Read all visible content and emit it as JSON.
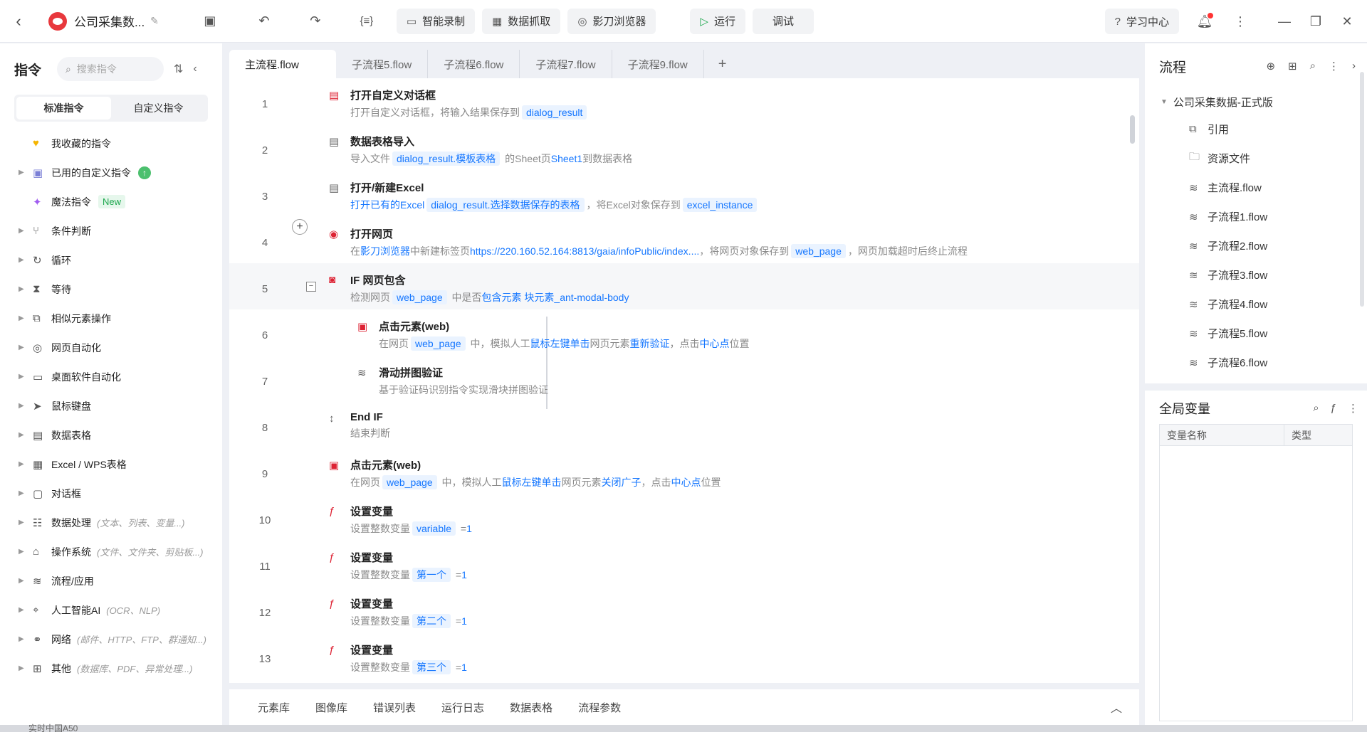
{
  "topbar": {
    "title": "公司采集数...",
    "buttons": {
      "record": "智能录制",
      "scrape": "数据抓取",
      "browser": "影刀浏览器",
      "run": "运行",
      "debug": "调试",
      "learn": "学习中心"
    }
  },
  "left": {
    "title": "指令",
    "search_placeholder": "搜索指令",
    "tabs": [
      "标准指令",
      "自定义指令"
    ],
    "items": [
      {
        "label": "我收藏的指令",
        "icon": "heart-icon",
        "arrow": false,
        "hint": ""
      },
      {
        "label": "已用的自定义指令",
        "icon": "calendar-check-icon",
        "arrow": true,
        "hint": ""
      },
      {
        "label": "魔法指令",
        "icon": "sparkle-icon",
        "arrow": false,
        "hint": ""
      },
      {
        "label": "条件判断",
        "icon": "branch-icon",
        "arrow": true,
        "hint": ""
      },
      {
        "label": "循环",
        "icon": "loop-icon",
        "arrow": true,
        "hint": ""
      },
      {
        "label": "等待",
        "icon": "hourglass-icon",
        "arrow": true,
        "hint": ""
      },
      {
        "label": "相似元素操作",
        "icon": "copy-icon",
        "arrow": true,
        "hint": ""
      },
      {
        "label": "网页自动化",
        "icon": "browser-icon",
        "arrow": true,
        "hint": ""
      },
      {
        "label": "桌面软件自动化",
        "icon": "monitor-icon",
        "arrow": true,
        "hint": ""
      },
      {
        "label": "鼠标键盘",
        "icon": "cursor-icon",
        "arrow": true,
        "hint": ""
      },
      {
        "label": "数据表格",
        "icon": "document-icon",
        "arrow": true,
        "hint": ""
      },
      {
        "label": "Excel / WPS表格",
        "icon": "excel-icon",
        "arrow": true,
        "hint": ""
      },
      {
        "label": "对话框",
        "icon": "dialog-icon",
        "arrow": true,
        "hint": ""
      },
      {
        "label": "数据处理",
        "icon": "data-process-icon",
        "arrow": true,
        "hint": "(文本、列表、变量...)"
      },
      {
        "label": "操作系统",
        "icon": "os-icon",
        "arrow": true,
        "hint": "(文件、文件夹、剪贴板...)"
      },
      {
        "label": "流程/应用",
        "icon": "layers-icon",
        "arrow": true,
        "hint": ""
      },
      {
        "label": "人工智能AI",
        "icon": "ai-icon",
        "arrow": true,
        "hint": "(OCR、NLP)"
      },
      {
        "label": "网络",
        "icon": "network-icon",
        "arrow": true,
        "hint": "(邮件、HTTP、FTP、群通知...)"
      },
      {
        "label": "其他",
        "icon": "grid-icon",
        "arrow": true,
        "hint": "(数据库、PDF、异常处理...)"
      }
    ],
    "new_badge": "New"
  },
  "editor": {
    "tabs": [
      "主流程.flow",
      "子流程5.flow",
      "子流程6.flow",
      "子流程7.flow",
      "子流程9.flow"
    ],
    "lines": [
      {
        "num": "1",
        "title": "打开自定义对话框",
        "parts": [
          [
            "t",
            "打开自定义对话框，将输入结果保存到"
          ],
          [
            "v",
            "dialog_result"
          ]
        ]
      },
      {
        "num": "2",
        "title": "数据表格导入",
        "parts": [
          [
            "t",
            "导入文件"
          ],
          [
            "v",
            "dialog_result.模板表格"
          ],
          [
            "t",
            " 的Sheet页"
          ],
          [
            "l",
            "Sheet1"
          ],
          [
            "t",
            "到数据表格"
          ]
        ]
      },
      {
        "num": "3",
        "title": "打开/新建Excel",
        "parts": [
          [
            "l",
            "打开已有的Excel"
          ],
          [
            "v",
            "dialog_result.选择数据保存的表格"
          ],
          [
            "t",
            "，将Excel对象保存到"
          ],
          [
            "v",
            "excel_instance"
          ]
        ]
      },
      {
        "num": "4",
        "title": "打开网页",
        "parts": [
          [
            "t",
            "在"
          ],
          [
            "l",
            "影刀浏览器"
          ],
          [
            "t",
            "中新建标签页"
          ],
          [
            "l",
            "https://220.160.52.164:8813/gaia/infoPublic/index...."
          ],
          [
            "t",
            "，将网页对象保存到"
          ],
          [
            "v",
            "web_page"
          ],
          [
            "t",
            "，网页加载超时后终止流程"
          ]
        ]
      },
      {
        "num": "5",
        "title": "IF 网页包含",
        "parts": [
          [
            "t",
            "检测网页"
          ],
          [
            "v",
            "web_page"
          ],
          [
            "t",
            " 中是否"
          ],
          [
            "l",
            "包含元素 块元素_ant-modal-body"
          ]
        ]
      },
      {
        "num": "6",
        "title": "点击元素(web)",
        "parts": [
          [
            "t",
            "在网页"
          ],
          [
            "v",
            "web_page"
          ],
          [
            "t",
            " 中，模拟人工"
          ],
          [
            "l",
            "鼠标左键单击"
          ],
          [
            "t",
            "网页元素"
          ],
          [
            "l",
            "重新验证"
          ],
          [
            "t",
            "，点击"
          ],
          [
            "l",
            "中心点"
          ],
          [
            "t",
            "位置"
          ]
        ]
      },
      {
        "num": "7",
        "title": "滑动拼图验证",
        "parts": [
          [
            "t",
            "基于验证码识别指令实现滑块拼图验证"
          ]
        ]
      },
      {
        "num": "8",
        "title": "End IF",
        "parts": [
          [
            "t",
            "结束判断"
          ]
        ]
      },
      {
        "num": "9",
        "title": "点击元素(web)",
        "parts": [
          [
            "t",
            "在网页"
          ],
          [
            "v",
            "web_page"
          ],
          [
            "t",
            " 中，模拟人工"
          ],
          [
            "l",
            "鼠标左键单击"
          ],
          [
            "t",
            "网页元素"
          ],
          [
            "l",
            "关闭广子"
          ],
          [
            "t",
            "，点击"
          ],
          [
            "l",
            "中心点"
          ],
          [
            "t",
            "位置"
          ]
        ]
      },
      {
        "num": "10",
        "title": "设置变量",
        "parts": [
          [
            "t",
            "设置整数变量"
          ],
          [
            "v",
            "variable"
          ],
          [
            "t",
            " ="
          ],
          [
            "l",
            "1"
          ]
        ]
      },
      {
        "num": "11",
        "title": "设置变量",
        "parts": [
          [
            "t",
            "设置整数变量"
          ],
          [
            "v",
            "第一个"
          ],
          [
            "t",
            " ="
          ],
          [
            "l",
            "1"
          ]
        ]
      },
      {
        "num": "12",
        "title": "设置变量",
        "parts": [
          [
            "t",
            "设置整数变量"
          ],
          [
            "v",
            "第二个"
          ],
          [
            "t",
            " ="
          ],
          [
            "l",
            "1"
          ]
        ]
      },
      {
        "num": "13",
        "title": "设置变量",
        "parts": [
          [
            "t",
            "设置整数变量"
          ],
          [
            "v",
            "第三个"
          ],
          [
            "t",
            " ="
          ],
          [
            "l",
            "1"
          ]
        ]
      }
    ]
  },
  "bottom_tabs": [
    "元素库",
    "图像库",
    "错误列表",
    "运行日志",
    "数据表格",
    "流程参数"
  ],
  "right": {
    "title": "流程",
    "root": "公司采集数据-正式版",
    "items": [
      {
        "label": "引用",
        "icon": "reference-icon"
      },
      {
        "label": "资源文件",
        "icon": "folder-icon"
      },
      {
        "label": "主流程.flow",
        "icon": "layers-icon"
      },
      {
        "label": "子流程1.flow",
        "icon": "layers-icon"
      },
      {
        "label": "子流程2.flow",
        "icon": "layers-icon"
      },
      {
        "label": "子流程3.flow",
        "icon": "layers-icon"
      },
      {
        "label": "子流程4.flow",
        "icon": "layers-icon"
      },
      {
        "label": "子流程5.flow",
        "icon": "layers-icon"
      },
      {
        "label": "子流程6.flow",
        "icon": "layers-icon"
      }
    ],
    "global_vars_title": "全局变量",
    "columns": [
      "变量名称",
      "类型"
    ]
  },
  "os": {
    "taskbar_text": "实时中国A50"
  }
}
